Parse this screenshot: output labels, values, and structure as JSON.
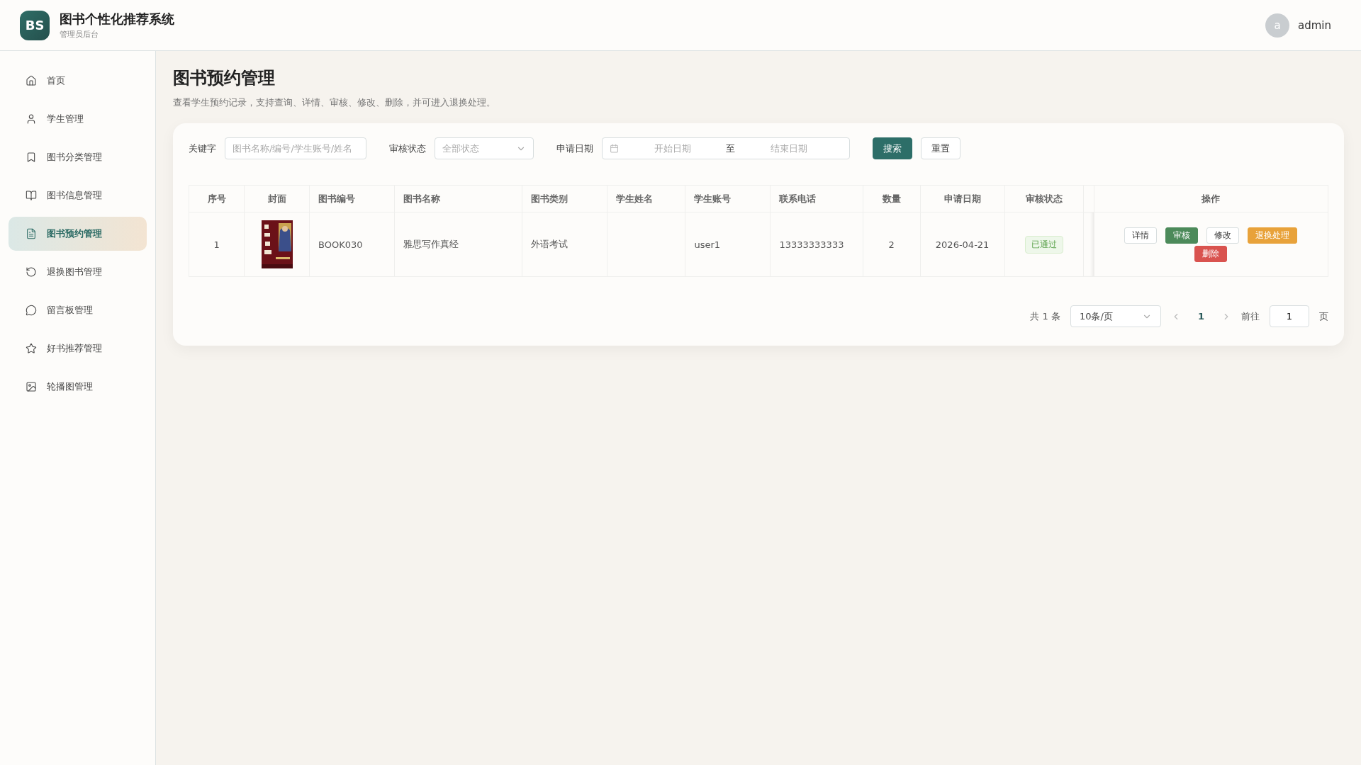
{
  "header": {
    "logo": "BS",
    "title": "图书个性化推荐系统",
    "subtitle": "管理员后台",
    "user": {
      "avatar": "a",
      "name": "admin"
    }
  },
  "sidebar": {
    "items": [
      {
        "label": "首页",
        "selected": false
      },
      {
        "label": "学生管理",
        "selected": false
      },
      {
        "label": "图书分类管理",
        "selected": false
      },
      {
        "label": "图书信息管理",
        "selected": false
      },
      {
        "label": "图书预约管理",
        "selected": true
      },
      {
        "label": "退换图书管理",
        "selected": false
      },
      {
        "label": "留言板管理",
        "selected": false
      },
      {
        "label": "好书推荐管理",
        "selected": false
      },
      {
        "label": "轮播图管理",
        "selected": false
      }
    ]
  },
  "page": {
    "title": "图书预约管理",
    "description": "查看学生预约记录，支持查询、详情、审核、修改、删除，并可进入退换处理。"
  },
  "filters": {
    "keyword": {
      "label": "关键字",
      "placeholder": "图书名称/编号/学生账号/姓名"
    },
    "status": {
      "label": "审核状态",
      "placeholder": "全部状态"
    },
    "date": {
      "label": "申请日期",
      "start_placeholder": "开始日期",
      "separator": "至",
      "end_placeholder": "结束日期"
    },
    "buttons": [
      {
        "label": "搜索",
        "kind": "primary"
      },
      {
        "label": "重置",
        "kind": "plain"
      }
    ]
  },
  "table": {
    "columns": [
      "序号",
      "封面",
      "图书编号",
      "图书名称",
      "图书类别",
      "学生姓名",
      "学生账号",
      "联系电话",
      "数量",
      "申请日期",
      "审核状态",
      "操作"
    ],
    "rows": [
      {
        "index": "1",
        "book_no": "BOOK030",
        "book_name": "雅思写作真经",
        "category": "外语考试",
        "account": "user1",
        "phone": "13333333333",
        "quantity": "2",
        "date": "2026-04-21",
        "status": {
          "label": "已通过",
          "kind": "success"
        },
        "actions": [
          {
            "label": "详情",
            "kind": "plain"
          },
          {
            "label": "审核",
            "kind": "success"
          },
          {
            "label": "修改",
            "kind": "plain"
          },
          {
            "label": "退换处理",
            "kind": "warning"
          },
          {
            "label": "删除",
            "kind": "danger"
          }
        ]
      }
    ]
  },
  "pagination": {
    "total": "共 1 条",
    "page_size": "10条/页",
    "pages": [
      {
        "label": "1",
        "selected": true
      }
    ],
    "goto_label": "前往",
    "goto_value": "1",
    "page_suffix": "页"
  }
}
